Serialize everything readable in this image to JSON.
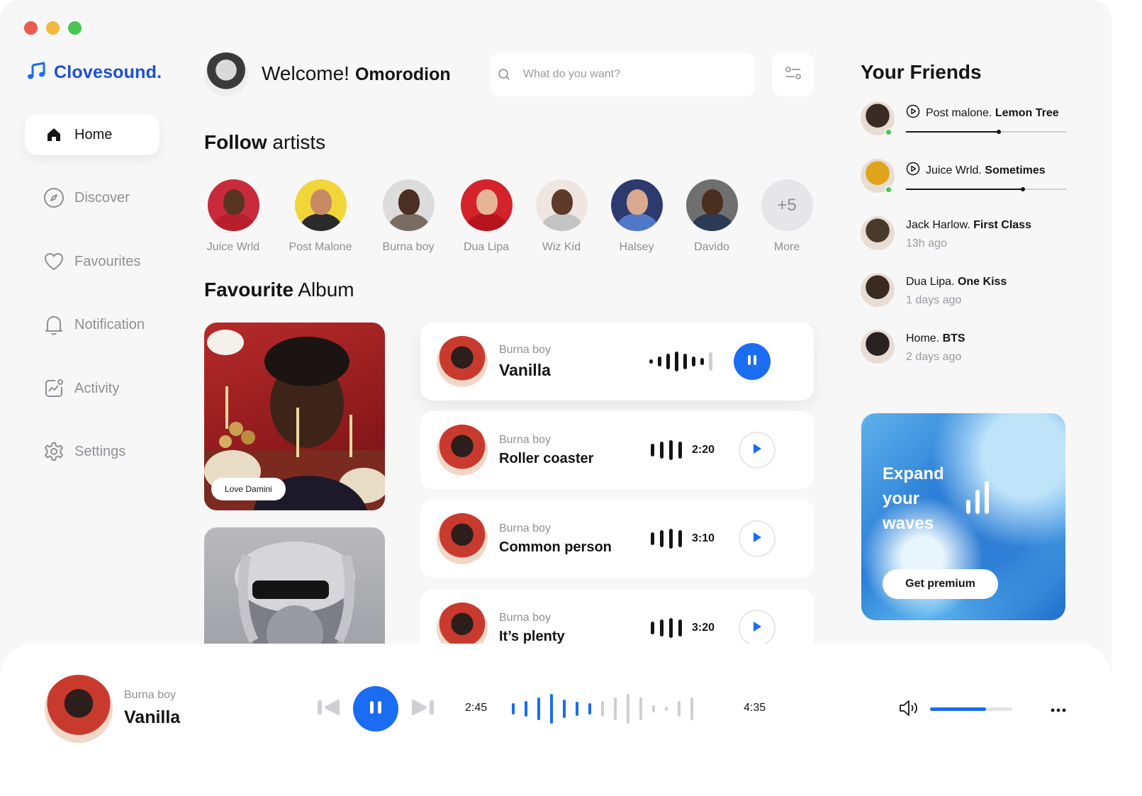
{
  "brand": {
    "name": "Clovesound.",
    "accent": "#1a6cf0"
  },
  "sidebar": {
    "items": [
      {
        "label": "Home",
        "icon": "home-icon",
        "active": true
      },
      {
        "label": "Discover",
        "icon": "compass-icon"
      },
      {
        "label": "Favourites",
        "icon": "heart-icon"
      },
      {
        "label": "Notification",
        "icon": "bell-icon"
      },
      {
        "label": "Activity",
        "icon": "activity-icon"
      },
      {
        "label": "Settings",
        "icon": "gear-icon"
      }
    ]
  },
  "header": {
    "welcome": "Welcome!",
    "user_name": "Omorodion",
    "search_placeholder": "What do you want?"
  },
  "follow": {
    "title_bold": "Follow",
    "title_rest": " artists",
    "artists": [
      {
        "name": "Juice Wrld",
        "bg": "#c92a3c",
        "skin": "#5a3422",
        "cloth": "#b71f2c"
      },
      {
        "name": "Post Malone",
        "bg": "#f1d63a",
        "skin": "#c78a62",
        "cloth": "#2a2a2a"
      },
      {
        "name": "Burna boy",
        "bg": "#dcdcdc",
        "skin": "#4a2f22",
        "cloth": "#7a6c60"
      },
      {
        "name": "Dua Lipa",
        "bg": "#d4232b",
        "skin": "#e6b597",
        "cloth": "#b5141c"
      },
      {
        "name": "Wiz Kid",
        "bg": "#efe6e2",
        "skin": "#5e3a28",
        "cloth": "#c3c3c3"
      },
      {
        "name": "Halsey",
        "bg": "#2c3a6e",
        "skin": "#d9a88e",
        "cloth": "#5078c8"
      },
      {
        "name": "Davido",
        "bg": "#6f6f6f",
        "skin": "#4a2e20",
        "cloth": "#2b3a55"
      }
    ],
    "more_count": "+5",
    "more_label": "More"
  },
  "albums": {
    "title_bold": "Favourite",
    "title_rest": " Album",
    "tag": "Love Damini"
  },
  "tracks": [
    {
      "artist": "Burna boy",
      "song": "Vanilla",
      "duration": "",
      "playing": true
    },
    {
      "artist": "Burna boy",
      "song": "Roller coaster",
      "duration": "2:20"
    },
    {
      "artist": "Burna boy",
      "song": "Common person",
      "duration": "3:10"
    },
    {
      "artist": "Burna boy",
      "song": "It’s plenty",
      "duration": "3:20"
    }
  ],
  "friends": {
    "title": "Your Friends",
    "list": [
      {
        "artist": "Post malone.",
        "song": "Lemon Tree",
        "live": true,
        "progress": 0.58,
        "avatar": "#3b2a22"
      },
      {
        "artist": "Juice Wrld.",
        "song": "Sometimes",
        "live": true,
        "progress": 0.73,
        "avatar": "#e0a41c"
      },
      {
        "artist": "Jack Harlow.",
        "song": "First Class",
        "time": "13h ago",
        "avatar": "#4a3a2a"
      },
      {
        "artist": "Dua Lipa.",
        "song": "One Kiss",
        "time": "1 days ago",
        "avatar": "#3a2a20"
      },
      {
        "artist": "Home.",
        "song": "BTS",
        "time": "2 days ago",
        "avatar": "#2a2220"
      }
    ]
  },
  "premium": {
    "line1": "Expand",
    "line2": "your",
    "line3": "waves",
    "button": "Get premium"
  },
  "player": {
    "artist": "Burna boy",
    "song": "Vanilla",
    "elapsed": "2:45",
    "total": "4:35",
    "volume": 0.68
  }
}
